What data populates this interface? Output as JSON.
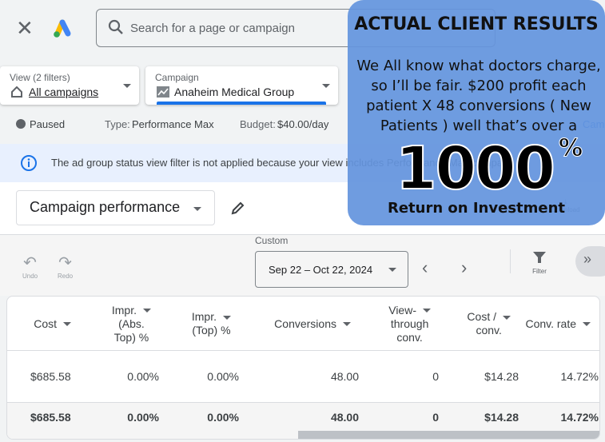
{
  "header": {
    "search_placeholder": "Search for a page or campaign"
  },
  "view_selector": {
    "label": "View (2 filters)",
    "value": "All campaigns"
  },
  "campaign_selector": {
    "label": "Campaign",
    "value": "Anaheim Medical Group"
  },
  "status_bar": {
    "status": "Paused",
    "type_label": "Type:",
    "type_value": "Performance Max",
    "budget_label": "Budget:",
    "budget_value": "$40.00/day",
    "campaign_link": "Cam"
  },
  "banner": {
    "text": "The ad group status view filter is not applied because your view includes Performance Max campa"
  },
  "performance": {
    "title": "Campaign performance",
    "download_label": "Download"
  },
  "toolbar": {
    "undo": "Undo",
    "redo": "Redo",
    "date_label": "Custom",
    "date_range": "Sep 22 – Oct 22, 2024",
    "filter": "Filter"
  },
  "table": {
    "columns": [
      {
        "l1": "Cost",
        "l2": "",
        "l3": ""
      },
      {
        "l1": "Impr.",
        "l2": "(Abs.",
        "l3": "Top) %"
      },
      {
        "l1": "Impr.",
        "l2": "(Top) %",
        "l3": ""
      },
      {
        "l1": "Conversions",
        "l2": "",
        "l3": ""
      },
      {
        "l1": "View-",
        "l2": "through",
        "l3": "conv."
      },
      {
        "l1": "Cost /",
        "l2": "conv.",
        "l3": ""
      },
      {
        "l1": "Conv. rate",
        "l2": "",
        "l3": ""
      }
    ],
    "row": [
      "$685.58",
      "0.00%",
      "0.00%",
      "48.00",
      "0",
      "$14.28",
      "14.72%"
    ],
    "total": [
      "$685.58",
      "0.00%",
      "0.00%",
      "48.00",
      "0",
      "$14.28",
      "14.72%"
    ]
  },
  "overlay": {
    "title": "ACTUAL CLIENT RESULTS",
    "body": "We All know what doctors charge, so I’ll be fair. $200 profit each patient X 48 conversions ( New Patients ) well that’s over a",
    "big": "1000",
    "pct": "%",
    "roi": "Return on Investment"
  }
}
